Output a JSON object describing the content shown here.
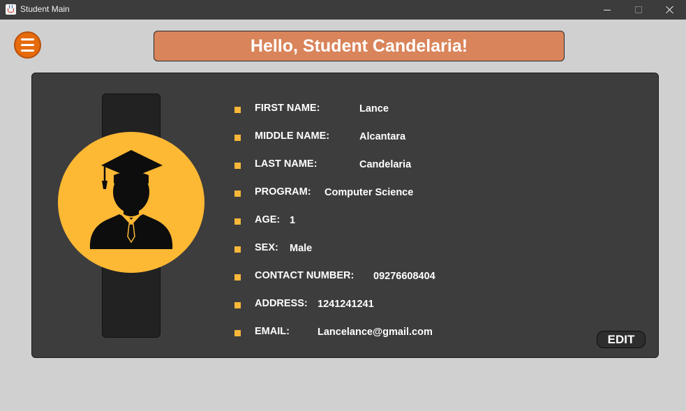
{
  "window": {
    "title": "Student Main",
    "icon": "java-cup-icon"
  },
  "header": {
    "greeting": "Hello, Student Candelaria!"
  },
  "profile": {
    "avatar_icon": "graduate-student-icon",
    "fields": [
      {
        "label": "FIRST NAME:",
        "value": "Lance"
      },
      {
        "label": "MIDDLE NAME:",
        "value": "Alcantara"
      },
      {
        "label": "LAST NAME:",
        "value": "Candelaria"
      },
      {
        "label": "PROGRAM:",
        "value": "Computer Science"
      },
      {
        "label": "AGE:",
        "value": "1"
      },
      {
        "label": "SEX:",
        "value": "Male"
      },
      {
        "label": "CONTACT NUMBER:",
        "value": "09276608404"
      },
      {
        "label": "ADDRESS:",
        "value": "1241241241"
      },
      {
        "label": "EMAIL:",
        "value": "Lancelance@gmail.com"
      }
    ]
  },
  "actions": {
    "edit_label": "EDIT"
  },
  "colors": {
    "accent_orange": "#e66b0d",
    "banner": "#d9845a",
    "avatar_yellow": "#fdb834",
    "card_bg": "#3d3d3d"
  }
}
